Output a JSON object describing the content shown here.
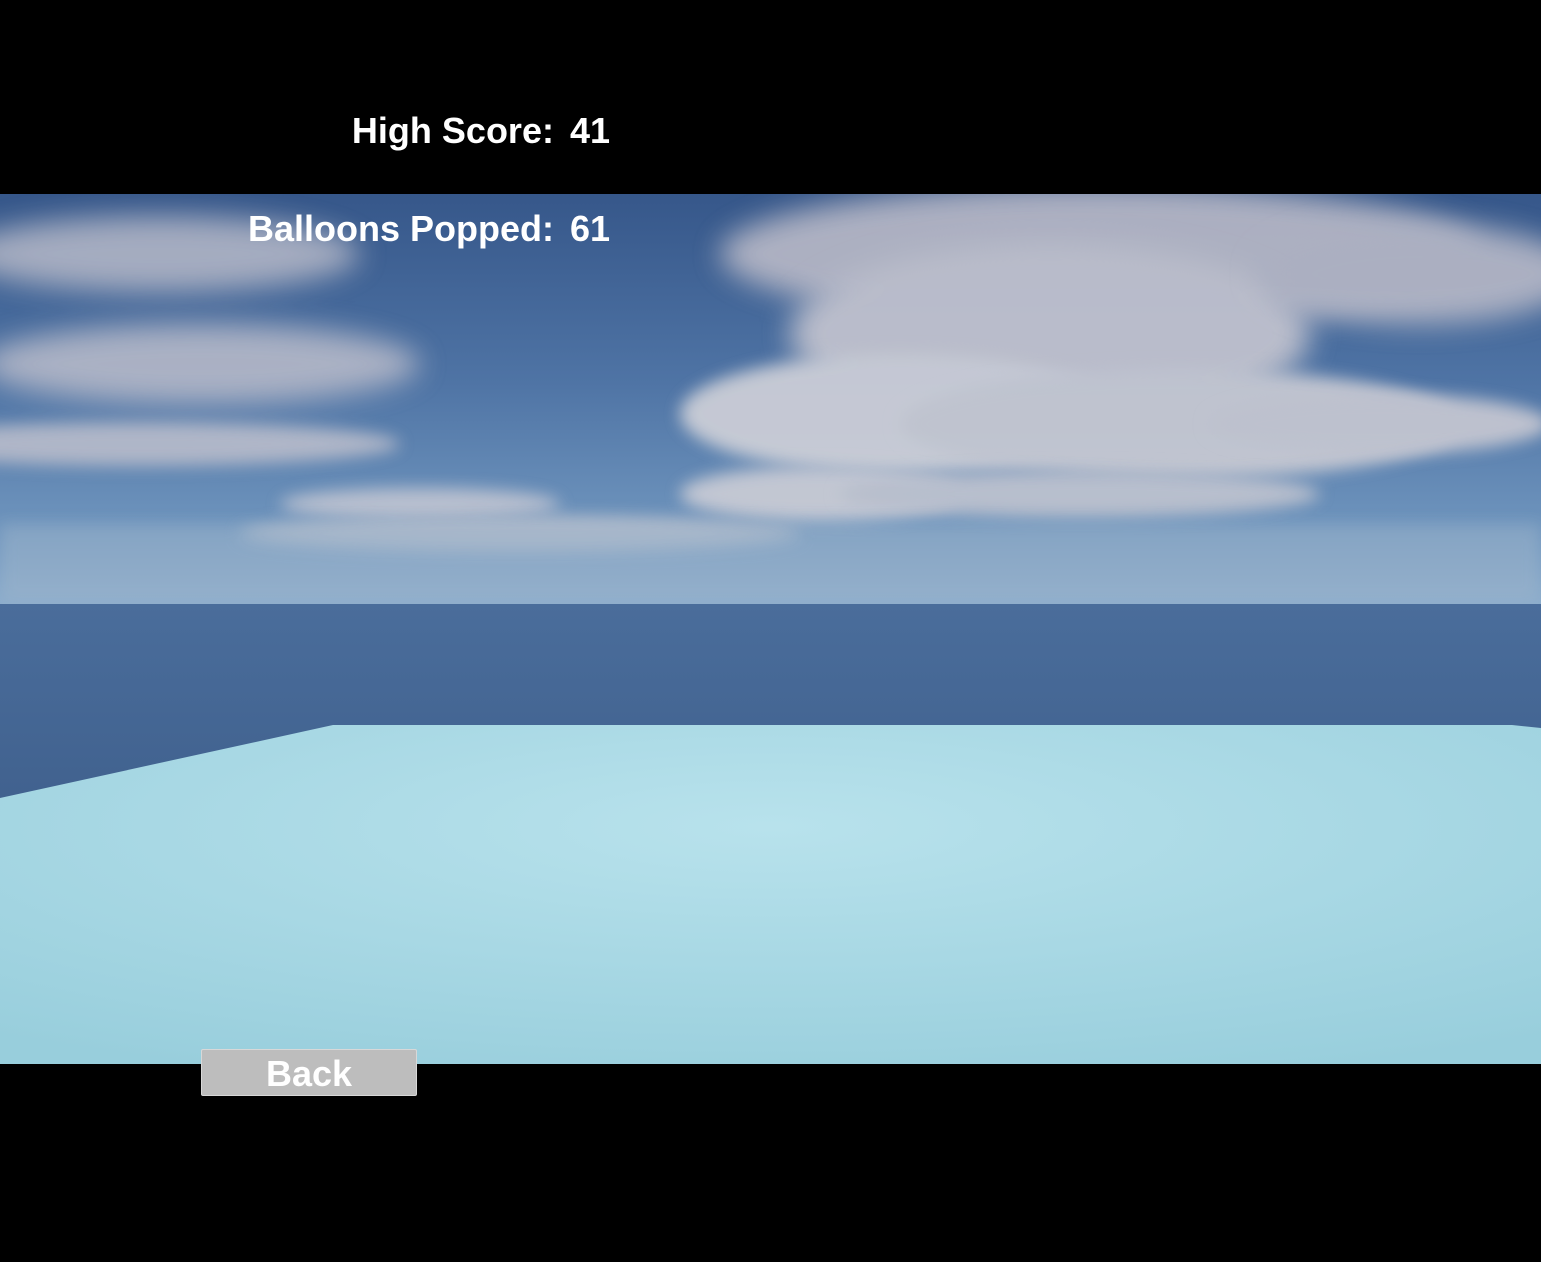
{
  "hud": {
    "high_score_label": "High Score:",
    "high_score_value": "41",
    "balloons_popped_label": "Balloons Popped:",
    "balloons_popped_value": "61"
  },
  "buttons": {
    "back_label": "Back"
  },
  "colors": {
    "letterbox": "#000000",
    "sky_top": "#3d5f93",
    "sky_horizon": "#6f93bb",
    "ocean": "#3b5b88",
    "floor": "#a7d8e5",
    "button_bg": "#bdbdbd",
    "text": "#ffffff"
  }
}
